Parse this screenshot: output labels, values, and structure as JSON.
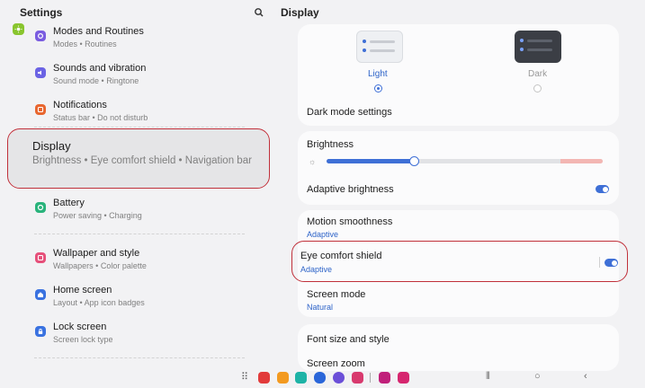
{
  "left_panel": {
    "title": "Settings",
    "search_icon": "search-icon",
    "items": [
      {
        "title": "Modes and Routines",
        "subtitle": "Modes  •  Routines",
        "icon": "modes-icon",
        "color": "#7a5ce0"
      },
      {
        "title": "Sounds and vibration",
        "subtitle": "Sound mode  •  Ringtone",
        "icon": "speaker-icon",
        "color": "#6b63e4"
      },
      {
        "title": "Notifications",
        "subtitle": "Status bar  •  Do not disturb",
        "icon": "bell-icon",
        "color": "#e8662f"
      },
      {
        "title": "Display",
        "subtitle": "Brightness  •  Eye comfort shield  •  Navigation bar",
        "icon": "sun-icon",
        "color": "#89c52e",
        "selected": true
      },
      {
        "title": "Battery",
        "subtitle": "Power saving  •  Charging",
        "icon": "battery-icon",
        "color": "#29b37b"
      },
      {
        "title": "Wallpaper and style",
        "subtitle": "Wallpapers  •  Color palette",
        "icon": "wallpaper-icon",
        "color": "#e6507a"
      },
      {
        "title": "Home screen",
        "subtitle": "Layout  •  App icon badges",
        "icon": "home-icon",
        "color": "#3a72e0"
      },
      {
        "title": "Lock screen",
        "subtitle": "Screen lock type",
        "icon": "lock-icon",
        "color": "#3a72e0"
      }
    ]
  },
  "right_panel": {
    "title": "Display",
    "modes": {
      "light_label": "Light",
      "dark_label": "Dark",
      "selected": "light",
      "dark_mode_settings": "Dark mode settings"
    },
    "brightness": {
      "label": "Brightness",
      "level_percent": 31,
      "adaptive_label": "Adaptive brightness",
      "adaptive_on": true
    },
    "motion": {
      "label": "Motion smoothness",
      "value": "Adaptive"
    },
    "eye_comfort": {
      "label": "Eye comfort shield",
      "value": "Adaptive",
      "on": true
    },
    "screen_mode": {
      "label": "Screen mode",
      "value": "Natural"
    },
    "font_size": {
      "label": "Font size and style"
    },
    "screen_zoom": {
      "label": "Screen zoom"
    }
  },
  "navbar": {
    "apps": [
      "flipboard-app-icon",
      "notes-app-icon",
      "store-app-icon",
      "messages-app-icon",
      "internet-app-icon",
      "gallery-app-icon",
      "bixby-app-icon",
      "flower-app-icon"
    ],
    "colors": {
      "accent": "#3e6fd6",
      "highlight": "#c0303a"
    }
  }
}
